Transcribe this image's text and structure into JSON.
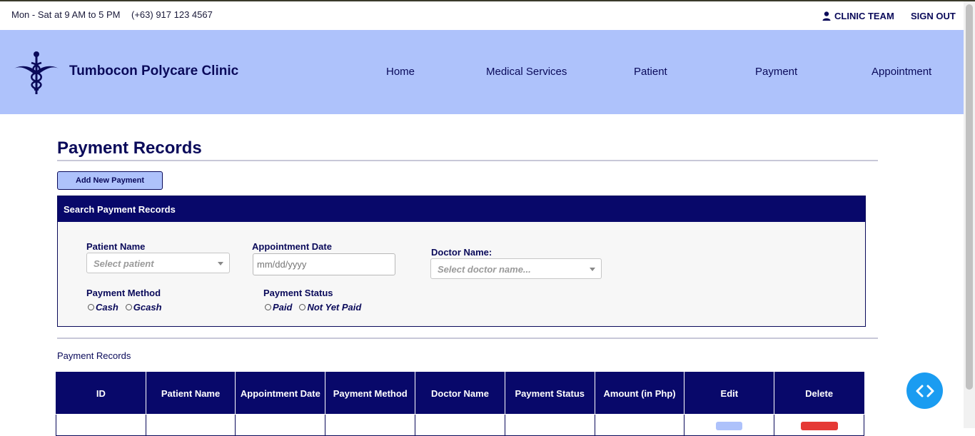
{
  "topbar": {
    "hours": "Mon - Sat at 9 AM to 5 PM",
    "phone": "(+63) 917 123 4567",
    "team_label": "CLINIC TEAM",
    "signout_label": "SIGN OUT"
  },
  "navbar": {
    "brand": "Tumbocon Polycare Clinic",
    "items": [
      {
        "label": "Home"
      },
      {
        "label": "Medical Services"
      },
      {
        "label": "Patient"
      },
      {
        "label": "Payment"
      },
      {
        "label": "Appointment"
      }
    ]
  },
  "page": {
    "title": "Payment Records",
    "add_button": "Add New Payment"
  },
  "search": {
    "heading": "Search Payment Records",
    "patient_name_label": "Patient Name",
    "patient_name_placeholder": "Select patient",
    "appointment_date_label": "Appointment Date",
    "appointment_date_placeholder": "mm/dd/yyyy",
    "doctor_name_label": "Doctor Name:",
    "doctor_name_placeholder": "Select doctor name...",
    "payment_method_label": "Payment Method",
    "payment_method_options": [
      "Cash",
      "Gcash"
    ],
    "payment_status_label": "Payment Status",
    "payment_status_options": [
      "Paid",
      "Not Yet Paid"
    ]
  },
  "records": {
    "label": "Payment Records",
    "columns": [
      "ID",
      "Patient Name",
      "Appointment Date",
      "Payment Method",
      "Doctor Name",
      "Payment Status",
      "Amount (in Php)",
      "Edit",
      "Delete"
    ]
  },
  "colors": {
    "navy": "#08086a",
    "nav_bg": "#aec2fb",
    "fab": "#1a9cf1",
    "delete": "#e53935"
  },
  "icons": {
    "user": "user-icon",
    "logo": "caduceus-icon",
    "fab": "code-icon"
  }
}
